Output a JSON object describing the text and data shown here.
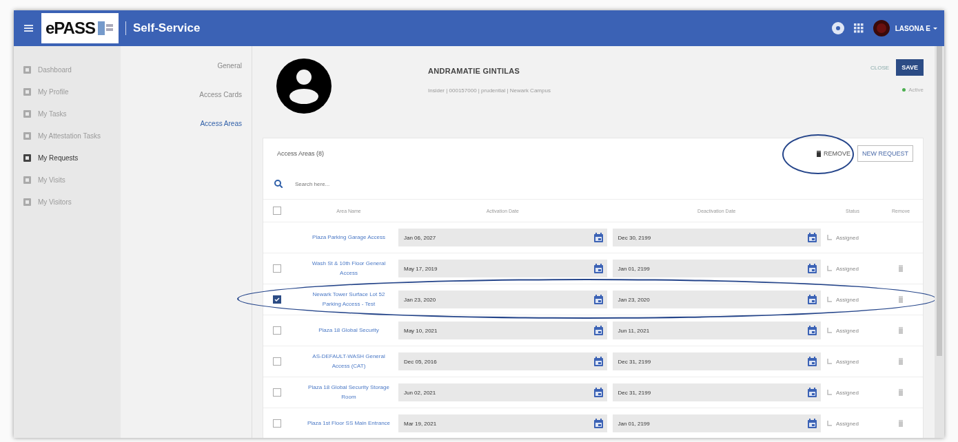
{
  "header": {
    "logo": "ePASS",
    "title": "Self-Service",
    "user": "LASONA E"
  },
  "sidebar": {
    "items": [
      {
        "label": "Dashboard",
        "selected": false
      },
      {
        "label": "My Profile",
        "selected": false
      },
      {
        "label": "My Tasks",
        "selected": false
      },
      {
        "label": "My Attestation Tasks",
        "selected": false
      },
      {
        "label": "My Requests",
        "selected": true
      },
      {
        "label": "My Visits",
        "selected": false
      },
      {
        "label": "My Visitors",
        "selected": false
      }
    ]
  },
  "profile_tabs": [
    {
      "label": "General",
      "selected": false
    },
    {
      "label": "Access Cards",
      "selected": false
    },
    {
      "label": "Access Areas",
      "selected": true
    }
  ],
  "person": {
    "name": "ANDRAMATIE GINTILAS",
    "details": "Insider | 000157000 | prudential | Newark Campus",
    "status": "Active"
  },
  "actions": [
    {
      "label": "CLOSE",
      "kind": "text"
    },
    {
      "label": "SAVE",
      "kind": "primary"
    }
  ],
  "access_areas": {
    "title": "Access Areas (8)",
    "remove_button": {
      "label": "REMOVE",
      "circled": true
    },
    "new_button": "NEW REQUEST",
    "search": {
      "placeholder": "Search here..."
    },
    "select_all": {
      "checked": false
    },
    "columns": [
      "Area Name",
      "Activation Date",
      "Deactivation Date",
      "Status",
      "Remove"
    ],
    "rows": [
      {
        "name": "Plaza Parking Garage Access",
        "activation": "Jan 06, 2027",
        "deactivation": "Dec 30, 2199",
        "status": "Assigned",
        "selectable": false,
        "removable": false,
        "circled": false
      },
      {
        "name": "Wash St & 10th Floor General Access",
        "activation": "May 17, 2019",
        "deactivation": "Jan 01, 2199",
        "status": "Assigned",
        "selectable": true,
        "checked": false,
        "removable": true,
        "circled": false
      },
      {
        "name": "Newark Tower Surface Lot 52 Parking Access - Test",
        "activation": "Jan 23, 2020",
        "deactivation": "Jan 23, 2020",
        "status": "Assigned",
        "selectable": true,
        "checked": true,
        "removable": true,
        "circled": true
      },
      {
        "name": "Plaza 18 Global Security",
        "activation": "May 10, 2021",
        "deactivation": "Jun 11, 2021",
        "status": "Assigned",
        "selectable": true,
        "checked": false,
        "removable": true,
        "circled": false
      },
      {
        "name": "AS-DEFAULT-WASH General Access (CAT)",
        "activation": "Dec 05, 2016",
        "deactivation": "Dec 31, 2199",
        "status": "Assigned",
        "selectable": true,
        "checked": false,
        "removable": true,
        "circled": false
      },
      {
        "name": "Plaza 18 Global Security Storage Room",
        "activation": "Jun 02, 2021",
        "deactivation": "Dec 31, 2199",
        "status": "Assigned",
        "selectable": true,
        "checked": false,
        "removable": true,
        "circled": false
      },
      {
        "name": "Plaza 1st Floor SS Main Entrance",
        "activation": "Mar 19, 2021",
        "deactivation": "Jan 01, 2199",
        "status": "Assigned",
        "selectable": true,
        "checked": false,
        "removable": true,
        "circled": false
      }
    ]
  }
}
